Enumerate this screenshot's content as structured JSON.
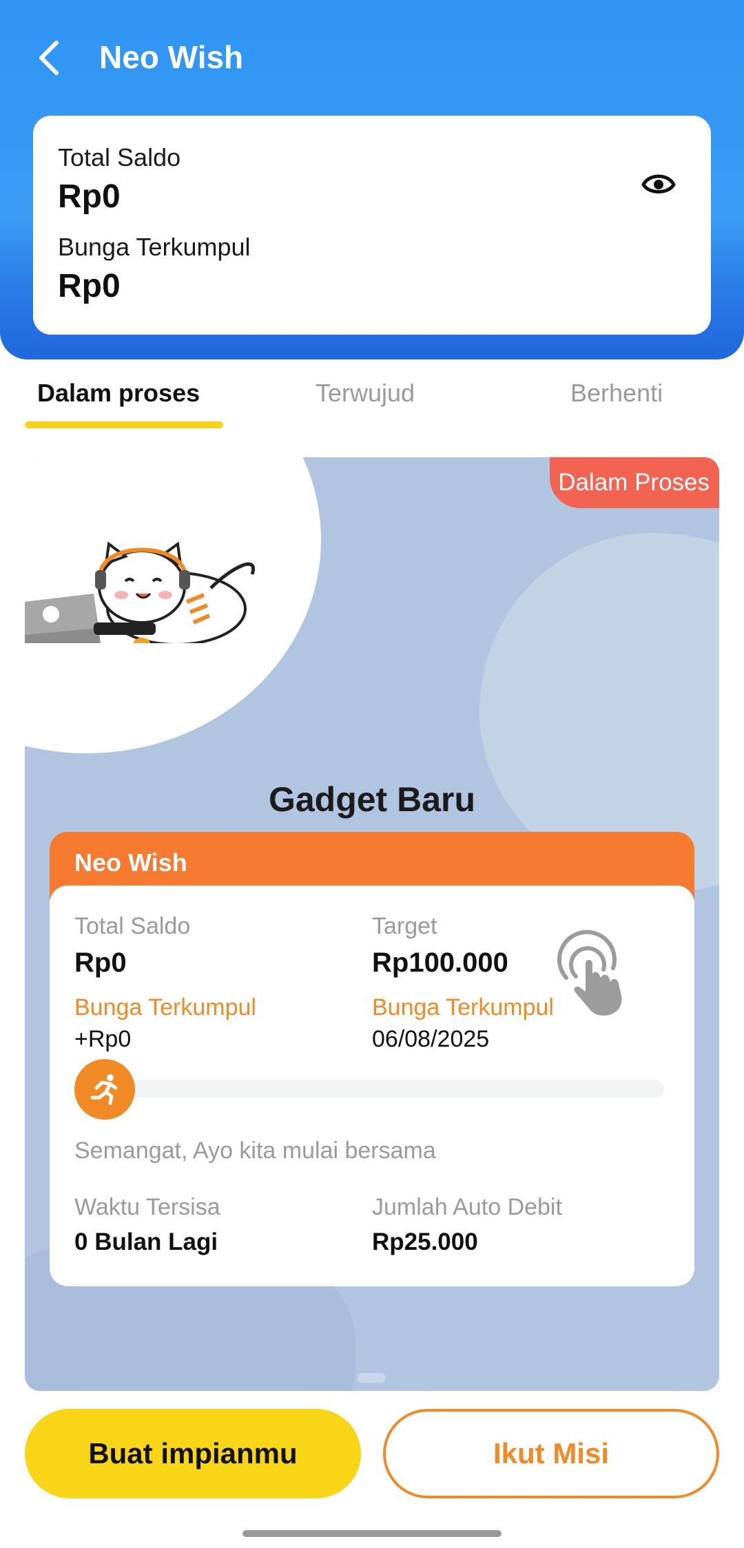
{
  "header": {
    "title": "Neo Wish",
    "back_icon": "chevron-left-icon"
  },
  "balance": {
    "total_label": "Total Saldo",
    "total_value": "Rp0",
    "interest_label": "Bunga Terkumpul",
    "interest_value": "Rp0",
    "visibility_icon": "eye-icon"
  },
  "tabs": [
    {
      "label": "Dalam proses",
      "active": true
    },
    {
      "label": "Terwujud",
      "active": false
    },
    {
      "label": "Berhenti",
      "active": false
    }
  ],
  "dream": {
    "status": "Dalam Proses",
    "title": "Gadget Baru",
    "card_header": "Neo Wish",
    "total_label": "Total Saldo",
    "total_value": "Rp0",
    "target_label": "Target",
    "target_value": "Rp100.000",
    "interest_label": "Bunga Terkumpul",
    "interest_value": "+Rp0",
    "interest_label_2": "Bunga Terkumpul",
    "date_value": "06/08/2025",
    "progress": 0,
    "motivation": "Semangat, Ayo kita mulai bersama",
    "remaining_label": "Waktu Tersisa",
    "remaining_value": "0 Bulan Lagi",
    "autodebit_label": "Jumlah Auto Debit",
    "autodebit_value": "Rp25.000"
  },
  "actions": {
    "primary_label": "Buat impianmu",
    "secondary_label": "Ikut Misi"
  },
  "colors": {
    "header_blue": "#2f95f3",
    "accent_yellow": "#f8d517",
    "accent_orange": "#f08a24",
    "status_red": "#f26352"
  }
}
